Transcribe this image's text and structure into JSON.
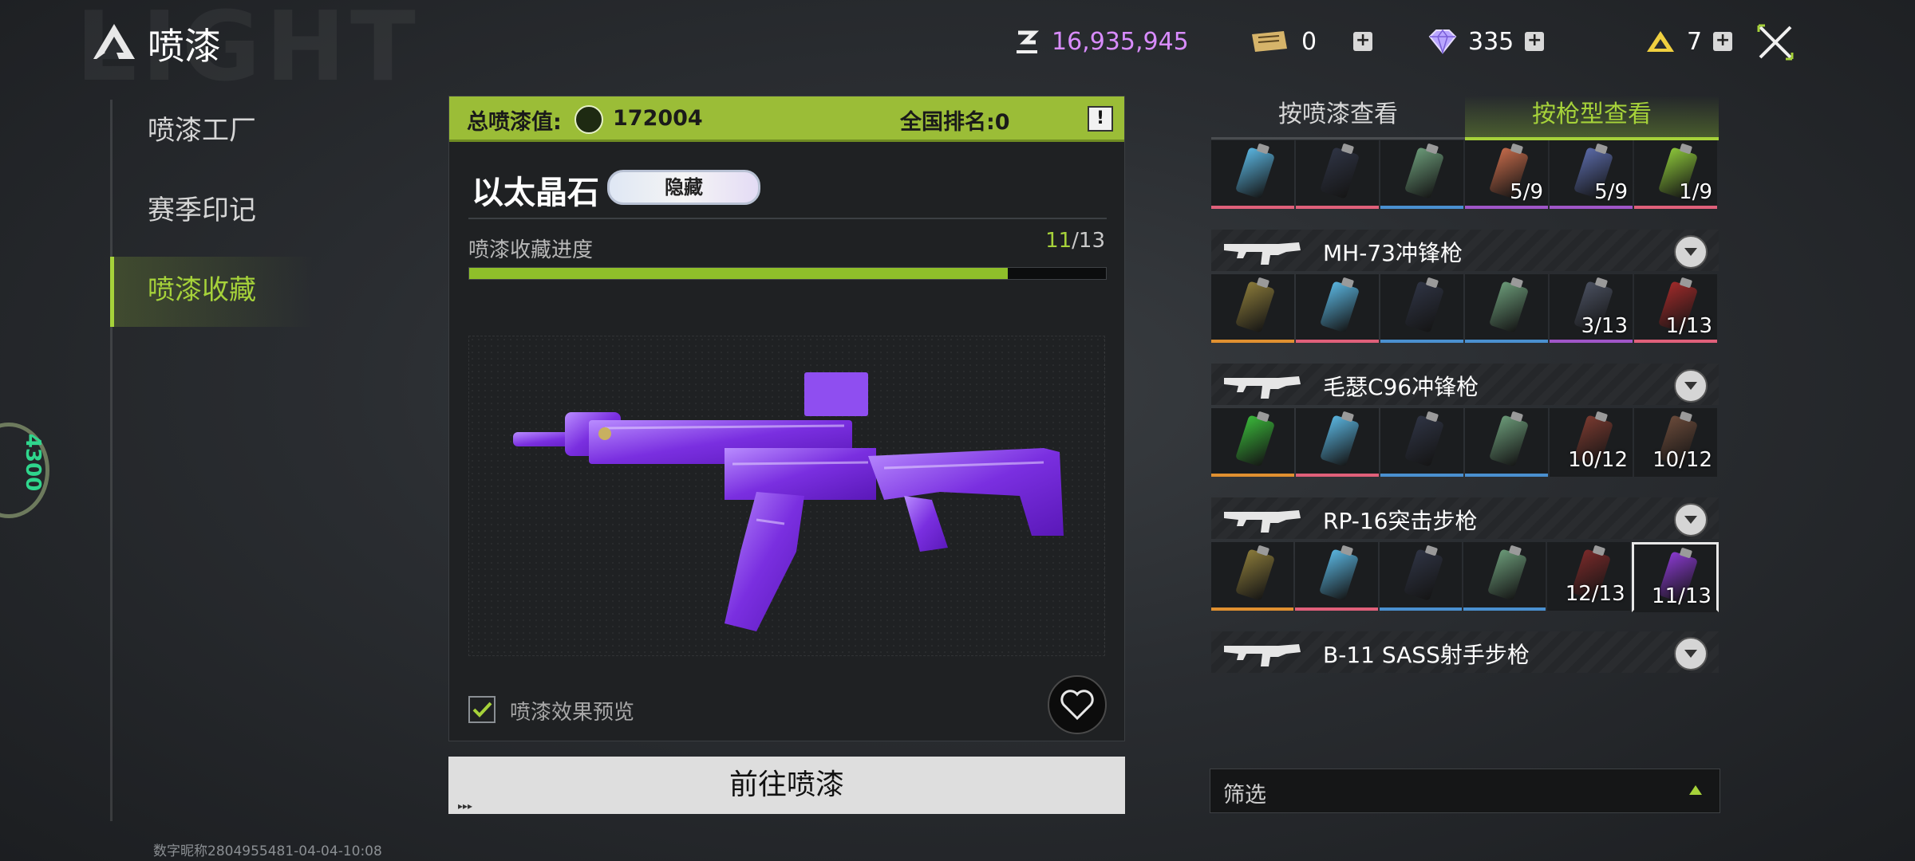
{
  "header": {
    "bg_word": "LIGHT",
    "title": "喷漆",
    "currencies": [
      {
        "name": "coin",
        "icon": "coin-icon",
        "value": "16,935,945",
        "color": "#d98cff"
      },
      {
        "name": "ticket",
        "icon": "ticket-icon",
        "value": "0"
      },
      {
        "name": "diamond",
        "icon": "diamond-icon",
        "value": "335"
      },
      {
        "name": "gold",
        "icon": "gold-triangle-icon",
        "value": "7"
      }
    ]
  },
  "nav": {
    "items": [
      {
        "label": "喷漆工厂",
        "active": false
      },
      {
        "label": "赛季印记",
        "active": false
      },
      {
        "label": "喷漆收藏",
        "active": true
      }
    ]
  },
  "watermark": "数字昵称2804955481-04-04-10:08",
  "side_badge": "4300",
  "panel": {
    "total_label": "总喷漆值:",
    "total_value": "172004",
    "rank_label": "全国排名:0",
    "info_icon": "!",
    "skin_name": "以太晶石",
    "tag": "隐藏",
    "progress_label": "喷漆收藏进度",
    "progress_current": "11",
    "progress_total": "/13",
    "progress_fraction": 0.846,
    "preview_label": "喷漆效果预览",
    "preview_checked": true,
    "go_button": "前往喷漆",
    "go_arrows": "▸▸▸"
  },
  "right": {
    "tabs": [
      {
        "label": "按喷漆查看",
        "active": false
      },
      {
        "label": "按枪型查看",
        "active": true
      }
    ],
    "rows": [
      {
        "gun": "",
        "cells": [
          {
            "can": "#5ab5e0",
            "edge": "#e0607a",
            "count": ""
          },
          {
            "can": "#2f3444",
            "edge": "#e0607a",
            "count": ""
          },
          {
            "can": "#6b9a78",
            "edge": "#4a90d0",
            "count": ""
          },
          {
            "can": "#c46a4a",
            "edge": "#a056c8",
            "count": "5/9"
          },
          {
            "can": "#5a6aa8",
            "edge": "#a056c8",
            "count": "5/9"
          },
          {
            "can": "#8cc63a",
            "edge": "#e0607a",
            "count": "1/9"
          }
        ]
      },
      {
        "gun": "MH-73冲锋枪",
        "cells": [
          {
            "can": "#8a7a3a",
            "edge": "#e09030",
            "count": ""
          },
          {
            "can": "#5ab5e0",
            "edge": "#e0607a",
            "count": ""
          },
          {
            "can": "#2f3444",
            "edge": "#4a90d0",
            "count": ""
          },
          {
            "can": "#6b9a78",
            "edge": "#4a90d0",
            "count": ""
          },
          {
            "can": "#4a5060",
            "edge": "#a056c8",
            "count": "3/13"
          },
          {
            "can": "#a02a2a",
            "edge": "#e0607a",
            "count": "1/13"
          }
        ]
      },
      {
        "gun": "毛瑟C96冲锋枪",
        "cells": [
          {
            "can": "#3ab83a",
            "edge": "#e09030",
            "count": ""
          },
          {
            "can": "#5ab5e0",
            "edge": "#e0607a",
            "count": ""
          },
          {
            "can": "#2f3444",
            "edge": "#4a90d0",
            "count": ""
          },
          {
            "can": "#6b9a78",
            "edge": "#4a90d0",
            "count": ""
          },
          {
            "can": "#7a3a30",
            "edge": "#1b1d1f",
            "count": "10/12"
          },
          {
            "can": "#6a4a3a",
            "edge": "#1b1d1f",
            "count": "10/12"
          }
        ]
      },
      {
        "gun": "RP-16突击步枪",
        "cells": [
          {
            "can": "#8a7a3a",
            "edge": "#e09030",
            "count": ""
          },
          {
            "can": "#5ab5e0",
            "edge": "#e0607a",
            "count": ""
          },
          {
            "can": "#2f3444",
            "edge": "#4a90d0",
            "count": ""
          },
          {
            "can": "#6b9a78",
            "edge": "#4a90d0",
            "count": ""
          },
          {
            "can": "#7a2a2a",
            "edge": "#1b1d1f",
            "count": "12/13"
          },
          {
            "can": "#8a3ad0",
            "edge": "#1b1d1f",
            "count": "11/13",
            "selected": true
          }
        ]
      },
      {
        "gun": "B-11 SASS射手步枪",
        "cells": []
      }
    ],
    "filter_label": "筛选"
  }
}
